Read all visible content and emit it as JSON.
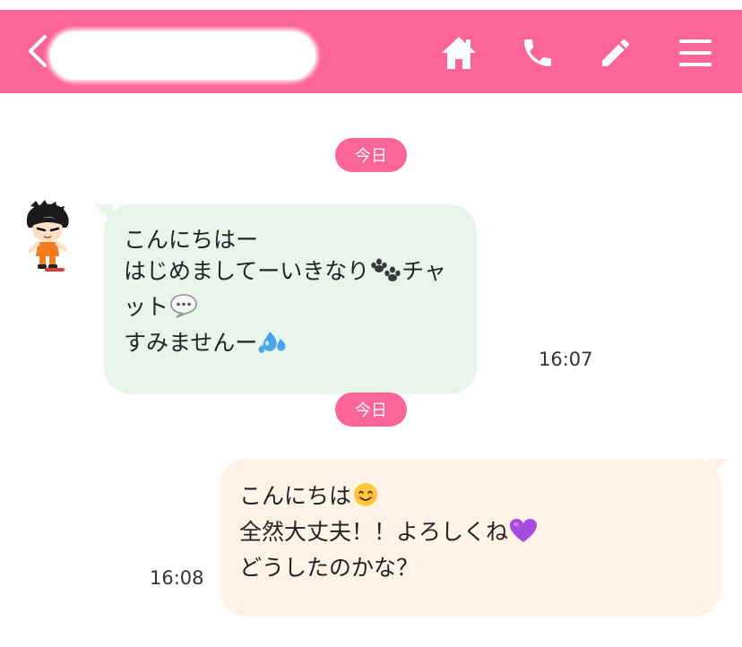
{
  "header": {
    "title": "",
    "back_icon": "chevron-left",
    "home_icon": "home",
    "call_icon": "phone",
    "compose_icon": "pencil",
    "menu_icon": "hamburger"
  },
  "colors": {
    "accent": "#fc6596",
    "incoming_bubble": "#e7f5ec",
    "outgoing_bubble": "#fff2e6"
  },
  "date_dividers": [
    "今日",
    "今日"
  ],
  "messages": [
    {
      "direction": "incoming",
      "lines": [
        "こんにちはー",
        "はじめましてーいきなり",
        "チャ",
        "ット",
        "すみませんー"
      ],
      "emoji": [
        "paw-prints",
        "speech-balloon",
        "sweat-droplets"
      ],
      "time": "16:07"
    },
    {
      "direction": "outgoing",
      "lines": [
        "こんにちは",
        "全然大丈夫！！よろしくね",
        "どうしたのかな？"
      ],
      "emoji": [
        "smiling-face",
        "purple-heart"
      ],
      "time": "16:08"
    }
  ]
}
